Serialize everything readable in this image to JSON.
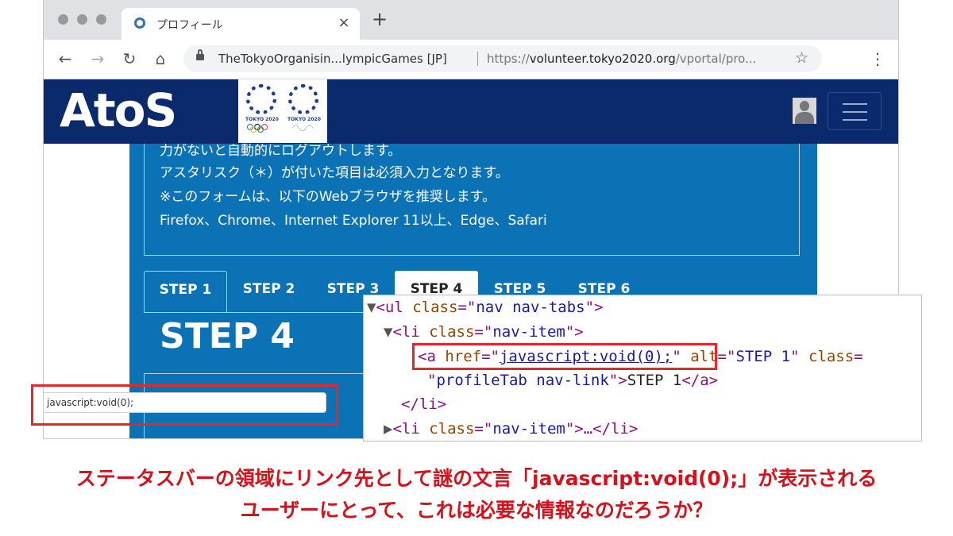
{
  "browser": {
    "tab_title": "プロフィール",
    "tab_close": "×",
    "new_tab": "+",
    "back": "←",
    "forward": "→",
    "reload": "↻",
    "home": "⌂",
    "site_identity": "TheTokyoOrganisin...lympicGames [JP]",
    "url_scheme": "https://",
    "url_host": "volunteer.tokyo2020.org",
    "url_path": "/vportal/pro...",
    "bookmark": "☆",
    "menu": "⋮",
    "icons": [
      "back-arrow-icon",
      "forward-arrow-icon",
      "reload-icon",
      "home-icon",
      "lock-icon",
      "star-icon",
      "kebab-menu-icon"
    ]
  },
  "header": {
    "logo": "AtoS",
    "olympic_label": "TOKYO 2020",
    "paralympic_label": "TOKYO 2020",
    "colors": {
      "header_bg": "#0a2a6b",
      "panel_bg": "#0a72b5"
    }
  },
  "notice": {
    "lines": [
      "力がないと自動的にログアウトします。",
      "アスタリスク（＊）が付いた項目は必須入力となります。",
      "※このフォームは、以下のWebブラウザを推奨します。",
      "Firefox、Chrome、Internet Explorer 11以上、Edge、Safari"
    ]
  },
  "steps": {
    "tabs": [
      "STEP 1",
      "STEP 2",
      "STEP 3",
      "STEP 4",
      "STEP 5",
      "STEP 6"
    ],
    "active": "STEP 4",
    "heading": "STEP 4"
  },
  "status_bar": {
    "text": "javascript:void(0);"
  },
  "devtools": {
    "line1": {
      "tri": "▼",
      "open": "<ul ",
      "attr": "class",
      "eq": "=\"",
      "val": "nav nav-tabs",
      "close": "\">"
    },
    "line2": {
      "tri": "▼",
      "open": "<li ",
      "attr": "class",
      "eq": "=\"",
      "val": "nav-item",
      "close": "\">"
    },
    "line3": {
      "open": "<a ",
      "attr1": "href",
      "eq1": "=\"",
      "href": "javascript:void(0);",
      "q1": "\"",
      "attr2": " alt",
      "eq2": "=\"",
      "alt": "STEP 1",
      "q2": "\"",
      "attr3": " class",
      "eq3": "="
    },
    "line4": {
      "q": "\"",
      "val": "profileTab nav-link",
      "close": "\">",
      "text": "STEP 1",
      "end": "</a>"
    },
    "line5": {
      "text": "</li>"
    },
    "line6": {
      "tri": "▶",
      "open": "<li ",
      "attr": "class",
      "eq": "=\"",
      "val": "nav-item",
      "close": "\">…</li>"
    }
  },
  "caption": {
    "line1": "ステータスバーの領域にリンク先として謎の文言「javascript:void(0);」が表示される",
    "line2": "ユーザーにとって、これは必要な情報なのだろうか？",
    "color": "#d4121b"
  }
}
